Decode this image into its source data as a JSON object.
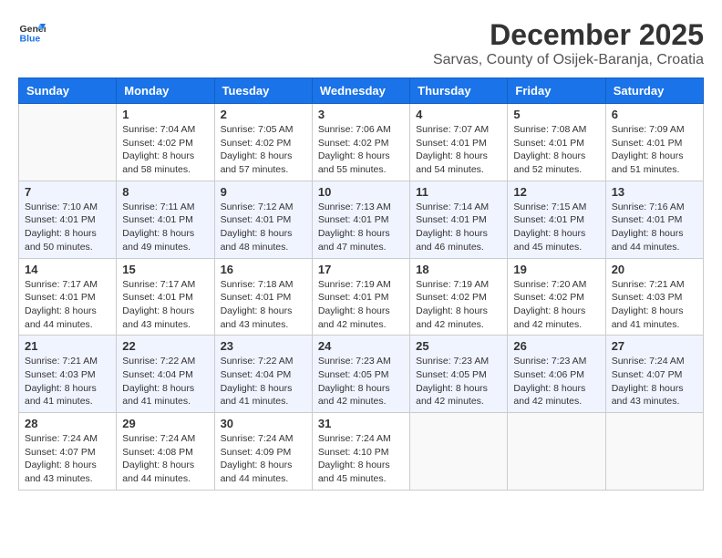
{
  "logo": {
    "text_general": "General",
    "text_blue": "Blue"
  },
  "title": {
    "month": "December 2025",
    "location": "Sarvas, County of Osijek-Baranja, Croatia"
  },
  "calendar": {
    "headers": [
      "Sunday",
      "Monday",
      "Tuesday",
      "Wednesday",
      "Thursday",
      "Friday",
      "Saturday"
    ],
    "rows": [
      [
        {
          "day": "",
          "info": ""
        },
        {
          "day": "1",
          "info": "Sunrise: 7:04 AM\nSunset: 4:02 PM\nDaylight: 8 hours\nand 58 minutes."
        },
        {
          "day": "2",
          "info": "Sunrise: 7:05 AM\nSunset: 4:02 PM\nDaylight: 8 hours\nand 57 minutes."
        },
        {
          "day": "3",
          "info": "Sunrise: 7:06 AM\nSunset: 4:02 PM\nDaylight: 8 hours\nand 55 minutes."
        },
        {
          "day": "4",
          "info": "Sunrise: 7:07 AM\nSunset: 4:01 PM\nDaylight: 8 hours\nand 54 minutes."
        },
        {
          "day": "5",
          "info": "Sunrise: 7:08 AM\nSunset: 4:01 PM\nDaylight: 8 hours\nand 52 minutes."
        },
        {
          "day": "6",
          "info": "Sunrise: 7:09 AM\nSunset: 4:01 PM\nDaylight: 8 hours\nand 51 minutes."
        }
      ],
      [
        {
          "day": "7",
          "info": "Sunrise: 7:10 AM\nSunset: 4:01 PM\nDaylight: 8 hours\nand 50 minutes."
        },
        {
          "day": "8",
          "info": "Sunrise: 7:11 AM\nSunset: 4:01 PM\nDaylight: 8 hours\nand 49 minutes."
        },
        {
          "day": "9",
          "info": "Sunrise: 7:12 AM\nSunset: 4:01 PM\nDaylight: 8 hours\nand 48 minutes."
        },
        {
          "day": "10",
          "info": "Sunrise: 7:13 AM\nSunset: 4:01 PM\nDaylight: 8 hours\nand 47 minutes."
        },
        {
          "day": "11",
          "info": "Sunrise: 7:14 AM\nSunset: 4:01 PM\nDaylight: 8 hours\nand 46 minutes."
        },
        {
          "day": "12",
          "info": "Sunrise: 7:15 AM\nSunset: 4:01 PM\nDaylight: 8 hours\nand 45 minutes."
        },
        {
          "day": "13",
          "info": "Sunrise: 7:16 AM\nSunset: 4:01 PM\nDaylight: 8 hours\nand 44 minutes."
        }
      ],
      [
        {
          "day": "14",
          "info": "Sunrise: 7:17 AM\nSunset: 4:01 PM\nDaylight: 8 hours\nand 44 minutes."
        },
        {
          "day": "15",
          "info": "Sunrise: 7:17 AM\nSunset: 4:01 PM\nDaylight: 8 hours\nand 43 minutes."
        },
        {
          "day": "16",
          "info": "Sunrise: 7:18 AM\nSunset: 4:01 PM\nDaylight: 8 hours\nand 43 minutes."
        },
        {
          "day": "17",
          "info": "Sunrise: 7:19 AM\nSunset: 4:01 PM\nDaylight: 8 hours\nand 42 minutes."
        },
        {
          "day": "18",
          "info": "Sunrise: 7:19 AM\nSunset: 4:02 PM\nDaylight: 8 hours\nand 42 minutes."
        },
        {
          "day": "19",
          "info": "Sunrise: 7:20 AM\nSunset: 4:02 PM\nDaylight: 8 hours\nand 42 minutes."
        },
        {
          "day": "20",
          "info": "Sunrise: 7:21 AM\nSunset: 4:03 PM\nDaylight: 8 hours\nand 41 minutes."
        }
      ],
      [
        {
          "day": "21",
          "info": "Sunrise: 7:21 AM\nSunset: 4:03 PM\nDaylight: 8 hours\nand 41 minutes."
        },
        {
          "day": "22",
          "info": "Sunrise: 7:22 AM\nSunset: 4:04 PM\nDaylight: 8 hours\nand 41 minutes."
        },
        {
          "day": "23",
          "info": "Sunrise: 7:22 AM\nSunset: 4:04 PM\nDaylight: 8 hours\nand 41 minutes."
        },
        {
          "day": "24",
          "info": "Sunrise: 7:23 AM\nSunset: 4:05 PM\nDaylight: 8 hours\nand 42 minutes."
        },
        {
          "day": "25",
          "info": "Sunrise: 7:23 AM\nSunset: 4:05 PM\nDaylight: 8 hours\nand 42 minutes."
        },
        {
          "day": "26",
          "info": "Sunrise: 7:23 AM\nSunset: 4:06 PM\nDaylight: 8 hours\nand 42 minutes."
        },
        {
          "day": "27",
          "info": "Sunrise: 7:24 AM\nSunset: 4:07 PM\nDaylight: 8 hours\nand 43 minutes."
        }
      ],
      [
        {
          "day": "28",
          "info": "Sunrise: 7:24 AM\nSunset: 4:07 PM\nDaylight: 8 hours\nand 43 minutes."
        },
        {
          "day": "29",
          "info": "Sunrise: 7:24 AM\nSunset: 4:08 PM\nDaylight: 8 hours\nand 44 minutes."
        },
        {
          "day": "30",
          "info": "Sunrise: 7:24 AM\nSunset: 4:09 PM\nDaylight: 8 hours\nand 44 minutes."
        },
        {
          "day": "31",
          "info": "Sunrise: 7:24 AM\nSunset: 4:10 PM\nDaylight: 8 hours\nand 45 minutes."
        },
        {
          "day": "",
          "info": ""
        },
        {
          "day": "",
          "info": ""
        },
        {
          "day": "",
          "info": ""
        }
      ]
    ]
  }
}
